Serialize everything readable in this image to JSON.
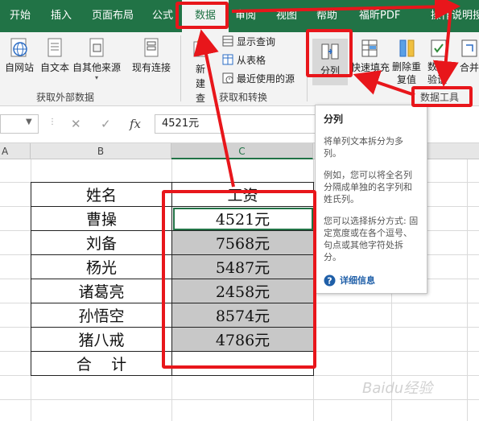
{
  "tabs": [
    "开始",
    "插入",
    "页面布局",
    "公式",
    "数据",
    "审阅",
    "视图",
    "帮助",
    "福昕PDF",
    "操作说明搜"
  ],
  "ribbon": {
    "get_external": {
      "buttons": [
        "自网站",
        "自文本",
        "自其他来源",
        "现有连接"
      ],
      "group_label": "获取外部数据"
    },
    "get_transform": {
      "new_query": "新建查询",
      "rows": [
        "显示查询",
        "从表格",
        "最近使用的源"
      ],
      "group_label": "获取和转换"
    },
    "data_tools": {
      "buttons": [
        "分列",
        "快速填充",
        "删除重复值",
        "数据验证",
        "合并"
      ],
      "group_label": "数据工具"
    }
  },
  "formula_bar": {
    "value": "4521元",
    "cancel": "✕",
    "confirm": "✓",
    "fx": "fx"
  },
  "columns": [
    "A",
    "B",
    "C"
  ],
  "table": {
    "header": [
      "姓名",
      "工资"
    ],
    "rows": [
      [
        "曹操",
        "4521元"
      ],
      [
        "刘备",
        "7568元"
      ],
      [
        "杨光",
        "5487元"
      ],
      [
        "诸葛亮",
        "2458元"
      ],
      [
        "孙悟空",
        "8574元"
      ],
      [
        "猪八戒",
        "4786元"
      ]
    ],
    "total_label": "合    计",
    "total_value": ""
  },
  "tooltip": {
    "title": "分列",
    "p1": "将单列文本拆分为多列。",
    "p2": "例如，您可以将全名列分隔成单独的名字列和姓氏列。",
    "p3": "您可以选择拆分方式: 固定宽度或在各个逗号、句点或其他字符处拆分。",
    "more": "详细信息"
  },
  "watermark": "Baidu经验",
  "colors": {
    "brand": "#217346",
    "annotation": "#e8161b",
    "shade": "#c8c8c8"
  }
}
